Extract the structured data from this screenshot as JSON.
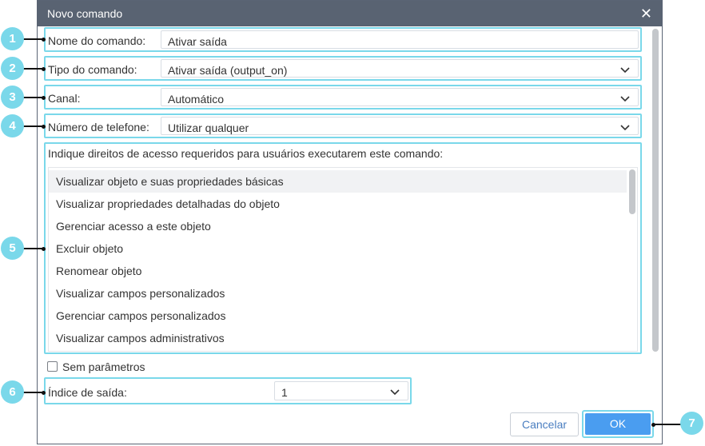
{
  "dialog": {
    "title": "Novo comando",
    "close_glyph": "✕"
  },
  "fields": {
    "name": {
      "label": "Nome do comando:",
      "value": "Ativar saída"
    },
    "type": {
      "label": "Tipo do comando:",
      "value": "Ativar saída (output_on)"
    },
    "channel": {
      "label": "Canal:",
      "value": "Automático"
    },
    "phone": {
      "label": "Número de telefone:",
      "value": "Utilizar qualquer"
    }
  },
  "access": {
    "hint": "Indique direitos de acesso requeridos para usuários executarem este comando:",
    "items": [
      "Visualizar objeto e suas propriedades básicas",
      "Visualizar propriedades detalhadas do objeto",
      "Gerenciar acesso a este objeto",
      "Excluir objeto",
      "Renomear objeto",
      "Visualizar campos personalizados",
      "Gerenciar campos personalizados",
      "Visualizar campos administrativos"
    ]
  },
  "no_params": {
    "label": "Sem parâmetros",
    "checked": false
  },
  "output_index": {
    "label": "Índice de saída:",
    "value": "1"
  },
  "buttons": {
    "cancel": "Cancelar",
    "ok": "OK"
  },
  "callouts": [
    "1",
    "2",
    "3",
    "4",
    "5",
    "6",
    "7"
  ],
  "colors": {
    "accent": "#7ad8ea",
    "primary": "#4a9df0",
    "titlebar": "#596372"
  },
  "icons": {
    "dropdown": "chevron-down-icon",
    "close": "close-icon"
  }
}
